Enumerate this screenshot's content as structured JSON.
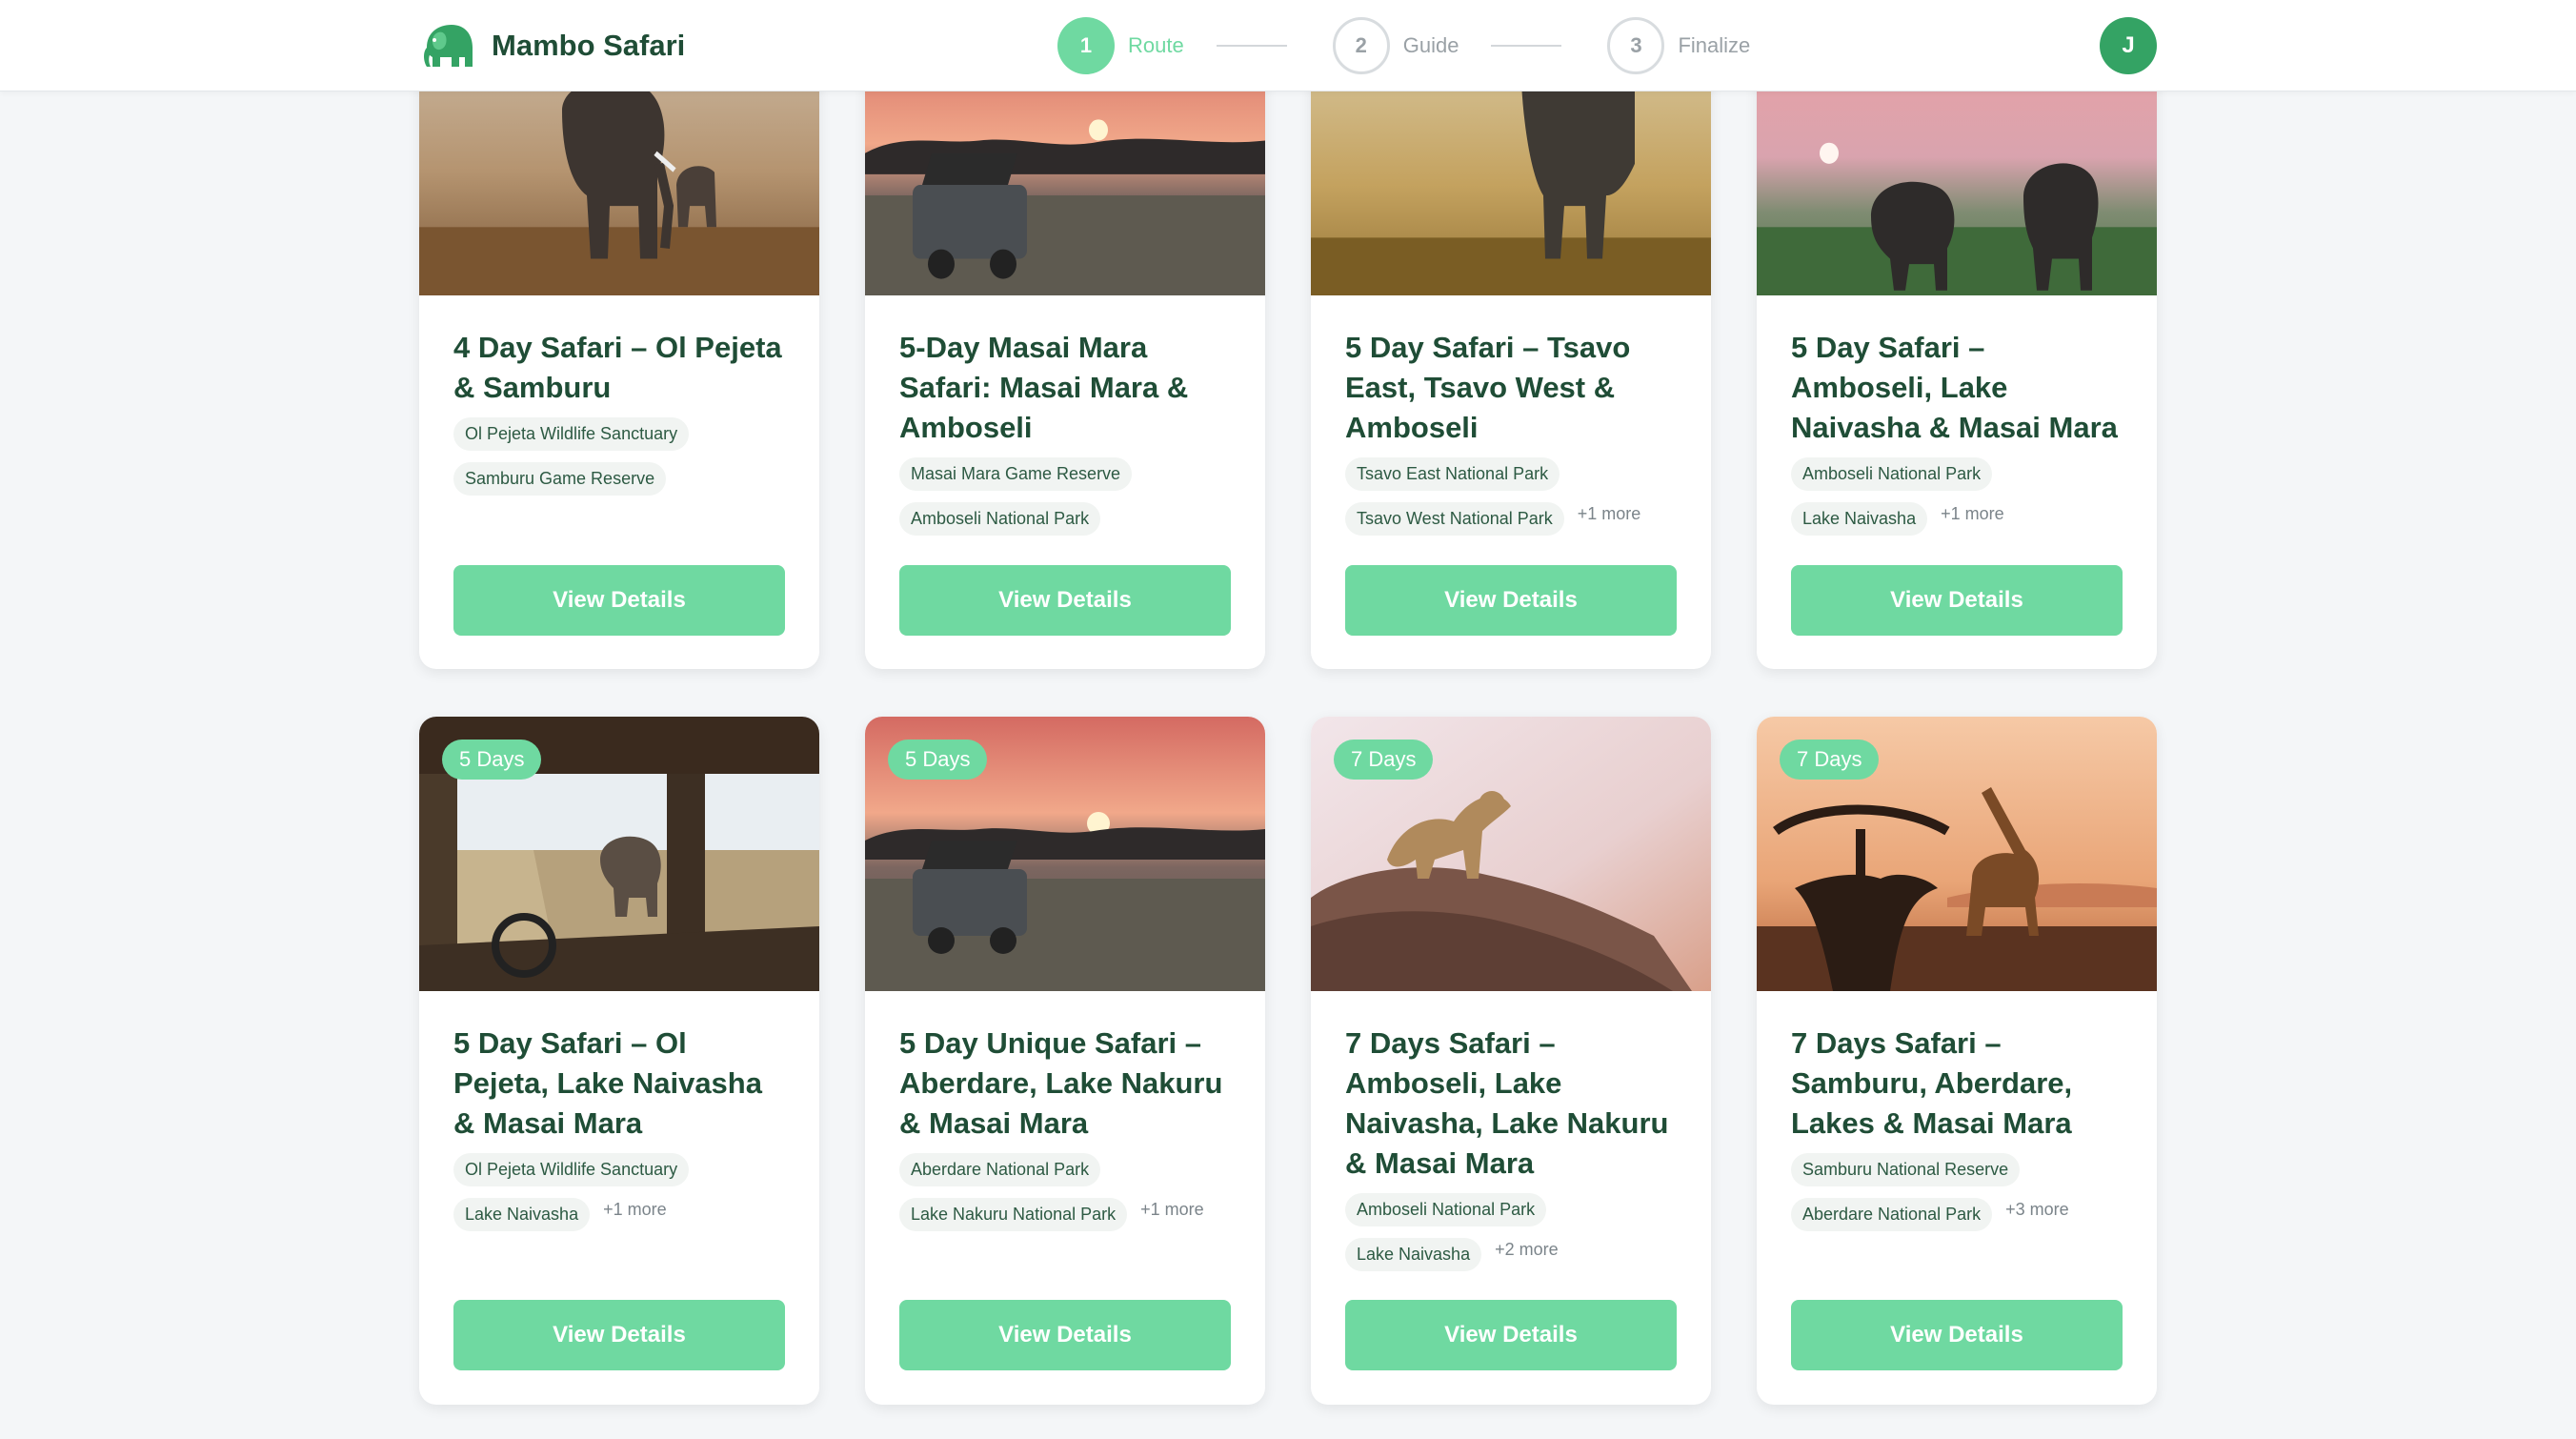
{
  "header": {
    "brand": "Mambo Safari",
    "steps": [
      {
        "number": "1",
        "label": "Route",
        "active": true
      },
      {
        "number": "2",
        "label": "Guide",
        "active": false
      },
      {
        "number": "3",
        "label": "Finalize",
        "active": false
      }
    ],
    "avatar_initial": "J"
  },
  "colors": {
    "accent": "#6fd9a1",
    "brand_text": "#1f4d36",
    "avatar": "#34a364",
    "background": "#f4f6f8"
  },
  "cards": [
    {
      "title": "4 Day Safari – Ol Pejeta & Samburu",
      "image": "elephants-in-savanna",
      "tags": [
        "Ol Pejeta Wildlife Sanctuary",
        "Samburu Game Reserve"
      ],
      "more": "",
      "button": "View Details"
    },
    {
      "title": "5-Day Masai Mara Safari: Masai Mara & Amboseli",
      "image": "safari-jeep-at-sunset",
      "tags": [
        "Masai Mara Game Reserve",
        "Amboseli National Park"
      ],
      "more": "",
      "button": "View Details"
    },
    {
      "title": "5 Day Safari – Tsavo East, Tsavo West & Amboseli",
      "image": "elephant-in-grassland",
      "tags": [
        "Tsavo East National Park",
        "Tsavo West National Park"
      ],
      "more": "+1 more",
      "button": "View Details"
    },
    {
      "title": "5 Day Safari – Amboseli, Lake Naivasha & Masai Mara",
      "image": "elephants-at-pink-dusk",
      "tags": [
        "Amboseli National Park",
        "Lake Naivasha"
      ],
      "more": "+1 more",
      "button": "View Details"
    },
    {
      "badge": "5 Days",
      "title": "5 Day Safari – Ol Pejeta, Lake Naivasha & Masai Mara",
      "image": "elephant-from-jeep",
      "tags": [
        "Ol Pejeta Wildlife Sanctuary",
        "Lake Naivasha"
      ],
      "more": "+1 more",
      "button": "View Details"
    },
    {
      "badge": "5 Days",
      "title": "5 Day Unique Safari – Aberdare, Lake Nakuru & Masai Mara",
      "image": "safari-jeep-at-sunset",
      "tags": [
        "Aberdare National Park",
        "Lake Nakuru National Park"
      ],
      "more": "+1 more",
      "button": "View Details"
    },
    {
      "badge": "7 Days",
      "title": "7 Days Safari – Amboseli, Lake Naivasha, Lake Nakuru & Masai Mara",
      "image": "leopard-on-rock",
      "tags": [
        "Amboseli National Park",
        "Lake Naivasha"
      ],
      "more": "+2 more",
      "button": "View Details"
    },
    {
      "badge": "7 Days",
      "title": "7 Days Safari – Samburu, Aberdare, Lakes & Masai Mara",
      "image": "giraffe-at-sunset",
      "tags": [
        "Samburu National Reserve",
        "Aberdare National Park"
      ],
      "more": "+3 more",
      "button": "View Details"
    }
  ]
}
